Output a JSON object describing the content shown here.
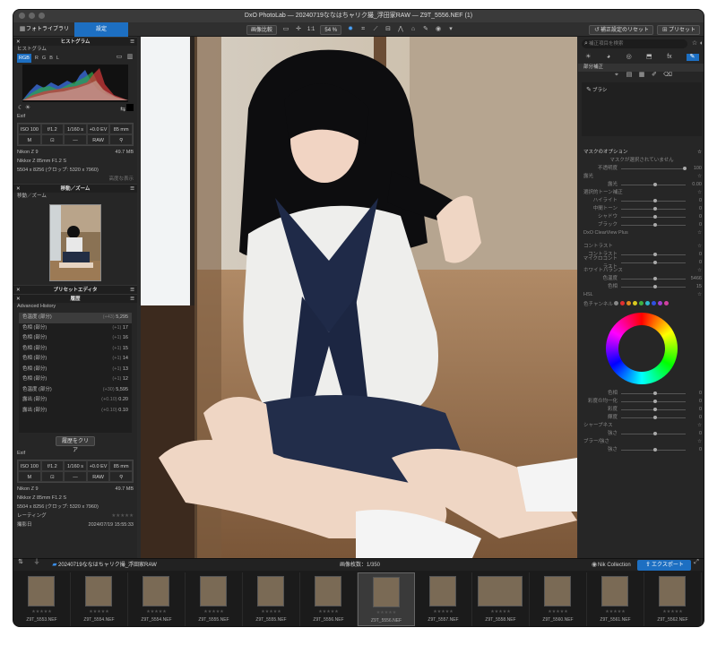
{
  "window": {
    "title": "DxO PhotoLab — 20240719ななはちャリク撮_浮田家RAW — Z9T_5556.NEF (1)"
  },
  "toolbar": {
    "tabs": [
      {
        "label": "フォトライブラリ"
      },
      {
        "label": "設定"
      }
    ],
    "compare_label": "画像比較",
    "zoom_fit": "1:1",
    "zoom_value": "54 %",
    "reset_label": "補正設定のリセット",
    "preset_label": "プリセット"
  },
  "left": {
    "histogram_title": "ヒストグラム",
    "histogram_sub": "ヒストグラム",
    "channels": [
      "RGB",
      "R",
      "G",
      "B",
      "L"
    ],
    "exif_label": "Exif",
    "exif_row1": [
      "ISO 100",
      "f/1.2",
      "1/160 s",
      "+0.0 EV",
      "85 mm"
    ],
    "exif_row2": [
      "M",
      "⊡",
      "—",
      "RAW",
      "⚲"
    ],
    "camera": "Nikon Z 9",
    "size": "49.7 MB",
    "lens": "Nikkor Z 85mm F1.2 S",
    "dimensions": "5504 x 8256 (クロップ: 5320 x 7960)",
    "advanced": "高度な表示",
    "move_zoom_title": "移動／ズーム",
    "move_zoom_sub": "移動／ズーム",
    "preset_editor_title": "プリセットエディタ",
    "history_title": "履歴",
    "history_sub": "Advanced History",
    "history_items": [
      {
        "name": "色温度 (部分)",
        "delta": "(+43)",
        "value": "5,295"
      },
      {
        "name": "色相 (部分)",
        "delta": "(+1)",
        "value": "17"
      },
      {
        "name": "色相 (部分)",
        "delta": "(+1)",
        "value": "16"
      },
      {
        "name": "色相 (部分)",
        "delta": "(+1)",
        "value": "15"
      },
      {
        "name": "色相 (部分)",
        "delta": "(+1)",
        "value": "14"
      },
      {
        "name": "色相 (部分)",
        "delta": "(+1)",
        "value": "13"
      },
      {
        "name": "色相 (部分)",
        "delta": "(+1)",
        "value": "12"
      },
      {
        "name": "色温度 (部分)",
        "delta": "(+30)",
        "value": "5,595"
      },
      {
        "name": "露出 (部分)",
        "delta": "(+0.10)",
        "value": "0.20"
      },
      {
        "name": "露出 (部分)",
        "delta": "(+0.10)",
        "value": "0.10"
      }
    ],
    "history_clear": "履歴をクリア",
    "exif2_label": "Exif",
    "rating_label": "レーティング",
    "date_label": "撮影日",
    "date_value": "2024/07/19 15:55:33"
  },
  "right": {
    "search_placeholder": "補正項目を検索",
    "local_label": "部分補正",
    "brush_label": "ブラシ",
    "mask_options": "マスクのオプション",
    "mask_none": "マスクが選択されていません",
    "opacity_label": "不透明度",
    "opacity_value": "100",
    "exposure_section": "露光",
    "exposure_label": "露光",
    "exposure_value": "0.00",
    "tone_section": "選択的トーン補正",
    "tone_items": [
      {
        "label": "ハイライト",
        "value": "0"
      },
      {
        "label": "中間トーン",
        "value": "0"
      },
      {
        "label": "シャドウ",
        "value": "0"
      },
      {
        "label": "ブラック",
        "value": "0"
      }
    ],
    "clearview_section": "DxO ClearView Plus",
    "contrast_section": "コントラスト",
    "contrast_items": [
      {
        "label": "コントラスト",
        "value": "0"
      },
      {
        "label": "マイクロコントラスト",
        "value": "0"
      }
    ],
    "wb_section": "ホワイトバランス",
    "wb_items": [
      {
        "label": "色温度",
        "value": "5466"
      },
      {
        "label": "色相",
        "value": "15"
      }
    ],
    "hsl_section": "HSL",
    "channel_label": "色チャンネル",
    "swatch_colors": [
      "#888888",
      "#e03030",
      "#e08a20",
      "#d8c820",
      "#40b040",
      "#30b8c8",
      "#3050e0",
      "#a040d0",
      "#d040a0"
    ],
    "hsl_items": [
      {
        "label": "色相",
        "value": "0"
      },
      {
        "label": "彩度の均一化",
        "value": "0"
      },
      {
        "label": "彩度",
        "value": "0"
      },
      {
        "label": "輝度",
        "value": "0"
      }
    ],
    "sharpen_section": "シャープネス",
    "sharpen_label": "強さ",
    "sharpen_value": "0",
    "blur_section": "ブラー/強さ",
    "blur_label": "強さ",
    "blur_value": "0"
  },
  "bottom": {
    "folder": "20240719ななはちャリク撮_浮田家RAW",
    "count": "画像枚数：1/350",
    "nik": "Nik Collection",
    "export": "エクスポート"
  },
  "film": [
    {
      "name": "Z9T_5553.NEF",
      "wide": false
    },
    {
      "name": "Z9T_5554.NEF",
      "wide": false
    },
    {
      "name": "Z9T_5554.NEF",
      "wide": false
    },
    {
      "name": "Z9T_5555.NEF",
      "wide": false
    },
    {
      "name": "Z9T_5555.NEF",
      "wide": false
    },
    {
      "name": "Z9T_5556.NEF",
      "wide": false
    },
    {
      "name": "Z9T_5556.NEF",
      "wide": false
    },
    {
      "name": "Z9T_5557.NEF",
      "wide": false
    },
    {
      "name": "Z9T_5558.NEF",
      "wide": true
    },
    {
      "name": "Z9T_5560.NEF",
      "wide": false
    },
    {
      "name": "Z9T_5561.NEF",
      "wide": false
    },
    {
      "name": "Z9T_5562.NEF",
      "wide": false
    }
  ],
  "colors": {
    "accent": "#1d6fc2"
  }
}
